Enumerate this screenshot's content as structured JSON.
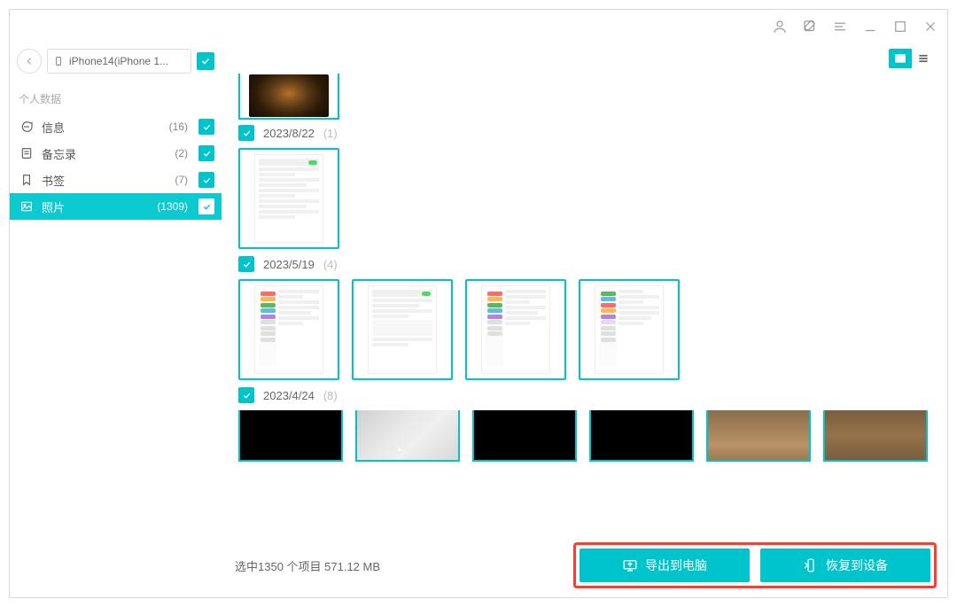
{
  "device": {
    "label": "iPhone14(iPhone 1..."
  },
  "sidebar": {
    "section_label": "个人数据",
    "items": [
      {
        "label": "信息",
        "count": "(16)"
      },
      {
        "label": "备忘录",
        "count": "(2)"
      },
      {
        "label": "书签",
        "count": "(7)"
      },
      {
        "label": "照片",
        "count": "(1309)"
      }
    ]
  },
  "groups": [
    {
      "date": "2023/8/22",
      "count": "(1)"
    },
    {
      "date": "2023/5/19",
      "count": "(4)"
    },
    {
      "date": "2023/4/24",
      "count": "(8)"
    }
  ],
  "footer": {
    "status": "选中1350 个项目 571.12 MB",
    "export_label": "导出到电脑",
    "restore_label": "恢复到设备"
  }
}
